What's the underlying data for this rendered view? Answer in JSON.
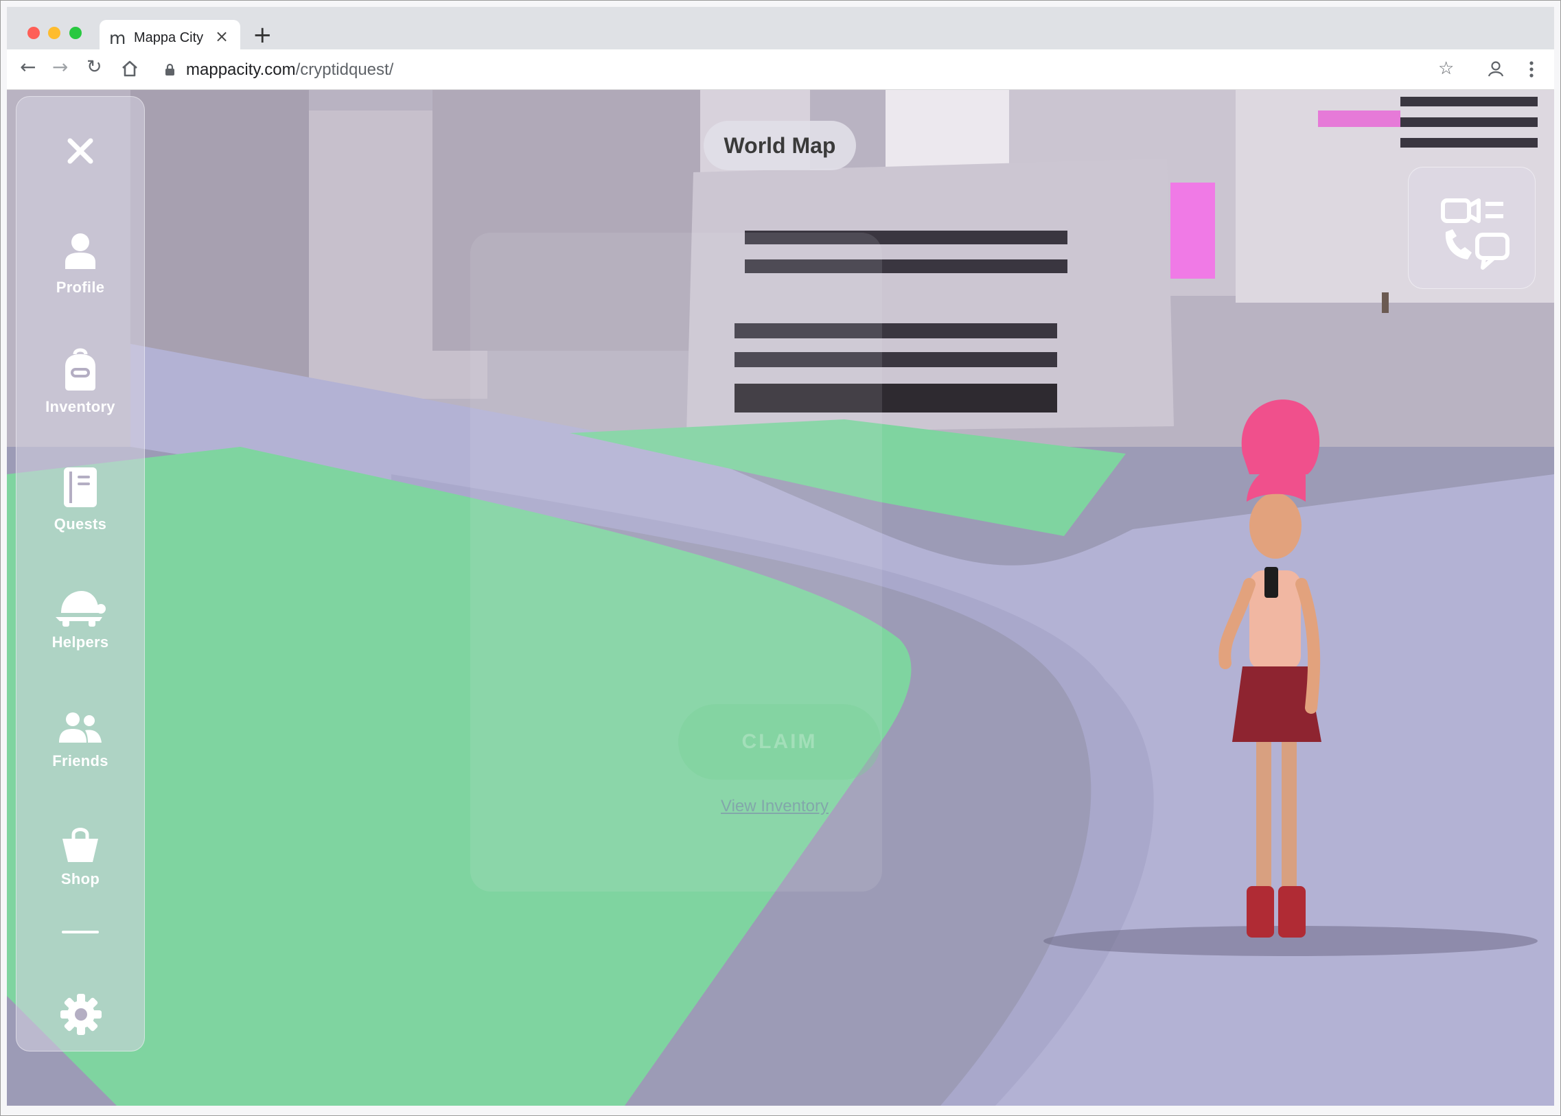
{
  "browser": {
    "tab_title": "Mappa City",
    "tab_favicon": "m",
    "url_host": "mappacity.com",
    "url_path": "/cryptidquest/"
  },
  "game": {
    "world_map_label": "World Map",
    "sidebar": {
      "items": [
        {
          "label": "Profile",
          "icon": "person-icon"
        },
        {
          "label": "Inventory",
          "icon": "backpack-icon"
        },
        {
          "label": "Quests",
          "icon": "book-icon"
        },
        {
          "label": "Helpers",
          "icon": "turtle-icon"
        },
        {
          "label": "Friends",
          "icon": "friends-icon"
        },
        {
          "label": "Shop",
          "icon": "shopping-bag-icon"
        }
      ]
    },
    "faded_panel": {
      "claim_label": "CLAIM",
      "link_label": "View Inventory"
    }
  },
  "colors": {
    "ground": "#9c9bb6",
    "grass": "#7fd4a0",
    "sidebar_bg": "#d6d2e2",
    "hair": "#f0508c"
  }
}
